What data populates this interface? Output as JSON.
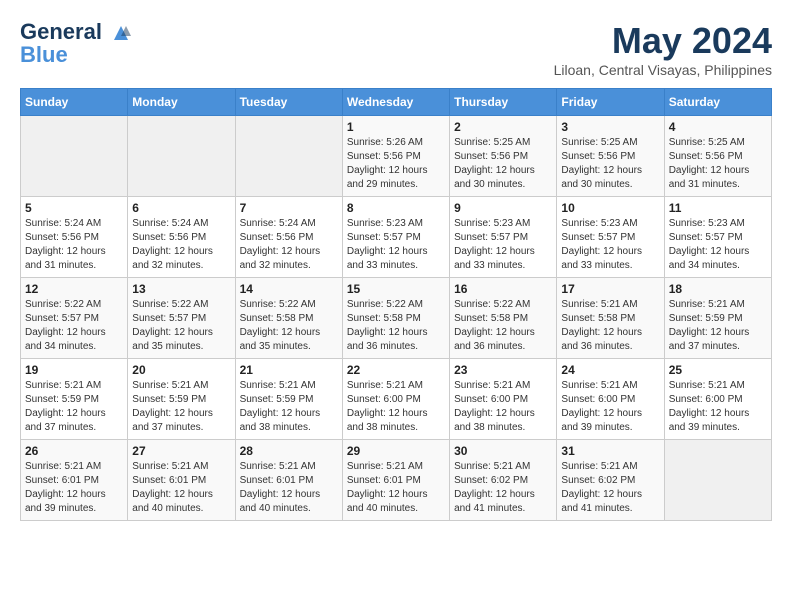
{
  "header": {
    "logo_line1": "General",
    "logo_line2": "Blue",
    "month": "May 2024",
    "location": "Liloan, Central Visayas, Philippines"
  },
  "weekdays": [
    "Sunday",
    "Monday",
    "Tuesday",
    "Wednesday",
    "Thursday",
    "Friday",
    "Saturday"
  ],
  "weeks": [
    [
      {
        "day": "",
        "info": ""
      },
      {
        "day": "",
        "info": ""
      },
      {
        "day": "",
        "info": ""
      },
      {
        "day": "1",
        "info": "Sunrise: 5:26 AM\nSunset: 5:56 PM\nDaylight: 12 hours\nand 29 minutes."
      },
      {
        "day": "2",
        "info": "Sunrise: 5:25 AM\nSunset: 5:56 PM\nDaylight: 12 hours\nand 30 minutes."
      },
      {
        "day": "3",
        "info": "Sunrise: 5:25 AM\nSunset: 5:56 PM\nDaylight: 12 hours\nand 30 minutes."
      },
      {
        "day": "4",
        "info": "Sunrise: 5:25 AM\nSunset: 5:56 PM\nDaylight: 12 hours\nand 31 minutes."
      }
    ],
    [
      {
        "day": "5",
        "info": "Sunrise: 5:24 AM\nSunset: 5:56 PM\nDaylight: 12 hours\nand 31 minutes."
      },
      {
        "day": "6",
        "info": "Sunrise: 5:24 AM\nSunset: 5:56 PM\nDaylight: 12 hours\nand 32 minutes."
      },
      {
        "day": "7",
        "info": "Sunrise: 5:24 AM\nSunset: 5:56 PM\nDaylight: 12 hours\nand 32 minutes."
      },
      {
        "day": "8",
        "info": "Sunrise: 5:23 AM\nSunset: 5:57 PM\nDaylight: 12 hours\nand 33 minutes."
      },
      {
        "day": "9",
        "info": "Sunrise: 5:23 AM\nSunset: 5:57 PM\nDaylight: 12 hours\nand 33 minutes."
      },
      {
        "day": "10",
        "info": "Sunrise: 5:23 AM\nSunset: 5:57 PM\nDaylight: 12 hours\nand 33 minutes."
      },
      {
        "day": "11",
        "info": "Sunrise: 5:23 AM\nSunset: 5:57 PM\nDaylight: 12 hours\nand 34 minutes."
      }
    ],
    [
      {
        "day": "12",
        "info": "Sunrise: 5:22 AM\nSunset: 5:57 PM\nDaylight: 12 hours\nand 34 minutes."
      },
      {
        "day": "13",
        "info": "Sunrise: 5:22 AM\nSunset: 5:57 PM\nDaylight: 12 hours\nand 35 minutes."
      },
      {
        "day": "14",
        "info": "Sunrise: 5:22 AM\nSunset: 5:58 PM\nDaylight: 12 hours\nand 35 minutes."
      },
      {
        "day": "15",
        "info": "Sunrise: 5:22 AM\nSunset: 5:58 PM\nDaylight: 12 hours\nand 36 minutes."
      },
      {
        "day": "16",
        "info": "Sunrise: 5:22 AM\nSunset: 5:58 PM\nDaylight: 12 hours\nand 36 minutes."
      },
      {
        "day": "17",
        "info": "Sunrise: 5:21 AM\nSunset: 5:58 PM\nDaylight: 12 hours\nand 36 minutes."
      },
      {
        "day": "18",
        "info": "Sunrise: 5:21 AM\nSunset: 5:59 PM\nDaylight: 12 hours\nand 37 minutes."
      }
    ],
    [
      {
        "day": "19",
        "info": "Sunrise: 5:21 AM\nSunset: 5:59 PM\nDaylight: 12 hours\nand 37 minutes."
      },
      {
        "day": "20",
        "info": "Sunrise: 5:21 AM\nSunset: 5:59 PM\nDaylight: 12 hours\nand 37 minutes."
      },
      {
        "day": "21",
        "info": "Sunrise: 5:21 AM\nSunset: 5:59 PM\nDaylight: 12 hours\nand 38 minutes."
      },
      {
        "day": "22",
        "info": "Sunrise: 5:21 AM\nSunset: 6:00 PM\nDaylight: 12 hours\nand 38 minutes."
      },
      {
        "day": "23",
        "info": "Sunrise: 5:21 AM\nSunset: 6:00 PM\nDaylight: 12 hours\nand 38 minutes."
      },
      {
        "day": "24",
        "info": "Sunrise: 5:21 AM\nSunset: 6:00 PM\nDaylight: 12 hours\nand 39 minutes."
      },
      {
        "day": "25",
        "info": "Sunrise: 5:21 AM\nSunset: 6:00 PM\nDaylight: 12 hours\nand 39 minutes."
      }
    ],
    [
      {
        "day": "26",
        "info": "Sunrise: 5:21 AM\nSunset: 6:01 PM\nDaylight: 12 hours\nand 39 minutes."
      },
      {
        "day": "27",
        "info": "Sunrise: 5:21 AM\nSunset: 6:01 PM\nDaylight: 12 hours\nand 40 minutes."
      },
      {
        "day": "28",
        "info": "Sunrise: 5:21 AM\nSunset: 6:01 PM\nDaylight: 12 hours\nand 40 minutes."
      },
      {
        "day": "29",
        "info": "Sunrise: 5:21 AM\nSunset: 6:01 PM\nDaylight: 12 hours\nand 40 minutes."
      },
      {
        "day": "30",
        "info": "Sunrise: 5:21 AM\nSunset: 6:02 PM\nDaylight: 12 hours\nand 41 minutes."
      },
      {
        "day": "31",
        "info": "Sunrise: 5:21 AM\nSunset: 6:02 PM\nDaylight: 12 hours\nand 41 minutes."
      },
      {
        "day": "",
        "info": ""
      }
    ]
  ]
}
